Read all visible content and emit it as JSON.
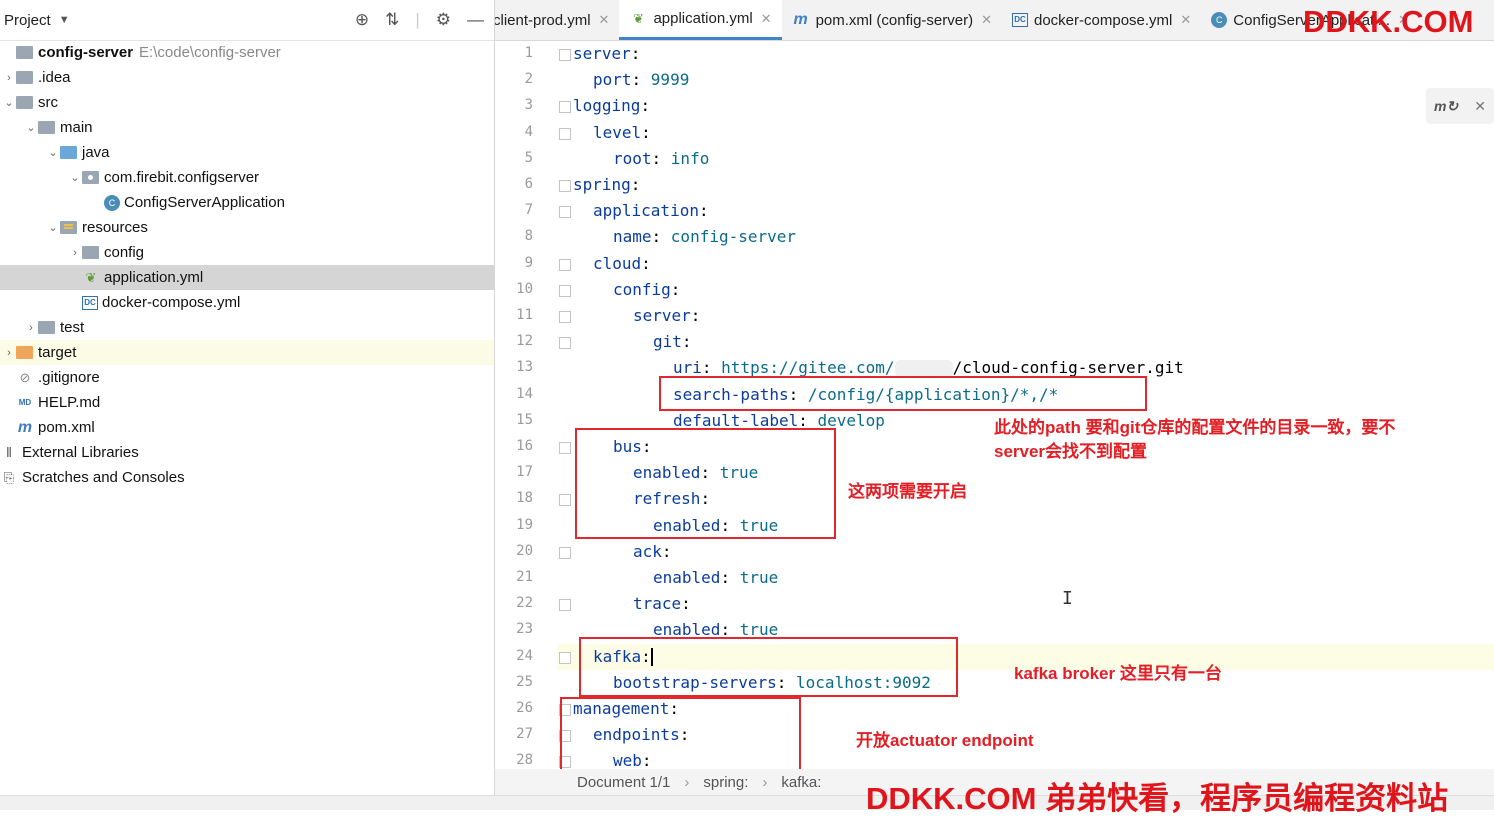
{
  "project_panel": {
    "title": "Project",
    "tree": [
      {
        "label": "config-server",
        "path": "E:\\code\\config-server",
        "indent": 0,
        "arrow": "",
        "icon": "folder",
        "bold": true
      },
      {
        "label": ".idea",
        "indent": 0,
        "arrow": ">",
        "icon": "folder"
      },
      {
        "label": "src",
        "indent": 0,
        "arrow": "v",
        "icon": "folder"
      },
      {
        "label": "main",
        "indent": 1,
        "arrow": "v",
        "icon": "folder"
      },
      {
        "label": "java",
        "indent": 2,
        "arrow": "v",
        "icon": "folder-blue"
      },
      {
        "label": "com.firebit.configserver",
        "indent": 3,
        "arrow": "v",
        "icon": "folder-pkg"
      },
      {
        "label": "ConfigServerApplication",
        "indent": 4,
        "arrow": "",
        "icon": "class"
      },
      {
        "label": "resources",
        "indent": 2,
        "arrow": "v",
        "icon": "folder-res"
      },
      {
        "label": "config",
        "indent": 3,
        "arrow": ">",
        "icon": "folder"
      },
      {
        "label": "application.yml",
        "indent": 3,
        "arrow": "",
        "icon": "spring-leaf",
        "selected": true
      },
      {
        "label": "docker-compose.yml",
        "indent": 3,
        "arrow": "",
        "icon": "docker-compose"
      },
      {
        "label": "test",
        "indent": 1,
        "arrow": ">",
        "icon": "folder"
      },
      {
        "label": "target",
        "indent": 0,
        "arrow": ">",
        "icon": "folder-orange",
        "excluded": true
      },
      {
        "label": ".gitignore",
        "indent": 0,
        "arrow": "",
        "icon": "gitignore"
      },
      {
        "label": "HELP.md",
        "indent": 0,
        "arrow": "",
        "icon": "markdown"
      },
      {
        "label": "pom.xml",
        "indent": 0,
        "arrow": "",
        "icon": "maven"
      },
      {
        "label": "External Libraries",
        "indent": -1,
        "arrow": "",
        "icon": "libraries"
      },
      {
        "label": "Scratches and Consoles",
        "indent": -1,
        "arrow": "",
        "icon": "scratches"
      }
    ]
  },
  "tabs": [
    {
      "label": "client-prod.yml",
      "icon": "",
      "active": false
    },
    {
      "label": "application.yml",
      "icon": "spring-leaf",
      "active": true
    },
    {
      "label": "pom.xml (config-server)",
      "icon": "maven",
      "active": false
    },
    {
      "label": "docker-compose.yml",
      "icon": "docker-compose",
      "active": false
    },
    {
      "label": "ConfigServerApplicati...",
      "icon": "class",
      "active": false
    }
  ],
  "editor": {
    "lines": [
      {
        "n": "1",
        "indent": 0,
        "key": "server",
        "val": ""
      },
      {
        "n": "2",
        "indent": 1,
        "key": "port",
        "val": "9999"
      },
      {
        "n": "3",
        "indent": 0,
        "key": "logging",
        "val": ""
      },
      {
        "n": "4",
        "indent": 1,
        "key": "level",
        "val": ""
      },
      {
        "n": "5",
        "indent": 2,
        "key": "root",
        "val": "info"
      },
      {
        "n": "6",
        "indent": 0,
        "key": "spring",
        "val": ""
      },
      {
        "n": "7",
        "indent": 1,
        "key": "application",
        "val": ""
      },
      {
        "n": "8",
        "indent": 2,
        "key": "name",
        "val": "config-server"
      },
      {
        "n": "9",
        "indent": 1,
        "key": "cloud",
        "val": ""
      },
      {
        "n": "10",
        "indent": 2,
        "key": "config",
        "val": ""
      },
      {
        "n": "11",
        "indent": 3,
        "key": "server",
        "val": ""
      },
      {
        "n": "12",
        "indent": 4,
        "key": "git",
        "val": ""
      },
      {
        "n": "13",
        "indent": 5,
        "key": "uri",
        "val": "https://gitee.com/",
        "val2": "/cloud-config-server.git"
      },
      {
        "n": "14",
        "indent": 5,
        "key": "search-paths",
        "val": "/config/{application}/*,/*"
      },
      {
        "n": "15",
        "indent": 5,
        "key": "default-label",
        "val": "develop"
      },
      {
        "n": "16",
        "indent": 2,
        "key": "bus",
        "val": ""
      },
      {
        "n": "17",
        "indent": 3,
        "key": "enabled",
        "val": "true"
      },
      {
        "n": "18",
        "indent": 3,
        "key": "refresh",
        "val": ""
      },
      {
        "n": "19",
        "indent": 4,
        "key": "enabled",
        "val": "true"
      },
      {
        "n": "20",
        "indent": 3,
        "key": "ack",
        "val": ""
      },
      {
        "n": "21",
        "indent": 4,
        "key": "enabled",
        "val": "true"
      },
      {
        "n": "22",
        "indent": 3,
        "key": "trace",
        "val": ""
      },
      {
        "n": "23",
        "indent": 4,
        "key": "enabled",
        "val": "true"
      },
      {
        "n": "24",
        "indent": 1,
        "key": "kafka",
        "val": "",
        "current": true
      },
      {
        "n": "25",
        "indent": 2,
        "key": "bootstrap-servers",
        "val": "localhost:9092"
      },
      {
        "n": "26",
        "indent": 0,
        "key": "management",
        "val": ""
      },
      {
        "n": "27",
        "indent": 1,
        "key": "endpoints",
        "val": ""
      },
      {
        "n": "28",
        "indent": 2,
        "key": "web",
        "val": ""
      }
    ]
  },
  "annotations": {
    "search_paths_note": "此处的path 要和git仓库的配置文件的目录一致，要不server会找不到配置",
    "bus_note": "这两项需要开启",
    "kafka_note": "kafka broker 这里只有一台",
    "management_note": "开放actuator endpoint"
  },
  "breadcrumb": {
    "document": "Document 1/1",
    "items": [
      "spring:",
      "kafka:"
    ]
  },
  "watermark": {
    "top": "DDKK.COM",
    "bottom": "DDKK.COM 弟弟快看，程序员编程资料站"
  },
  "colors": {
    "annotation_red": "#e0282e",
    "yaml_key": "#0a3c9e",
    "yaml_value": "#0b6b8a",
    "active_tab": "#4083c9"
  }
}
